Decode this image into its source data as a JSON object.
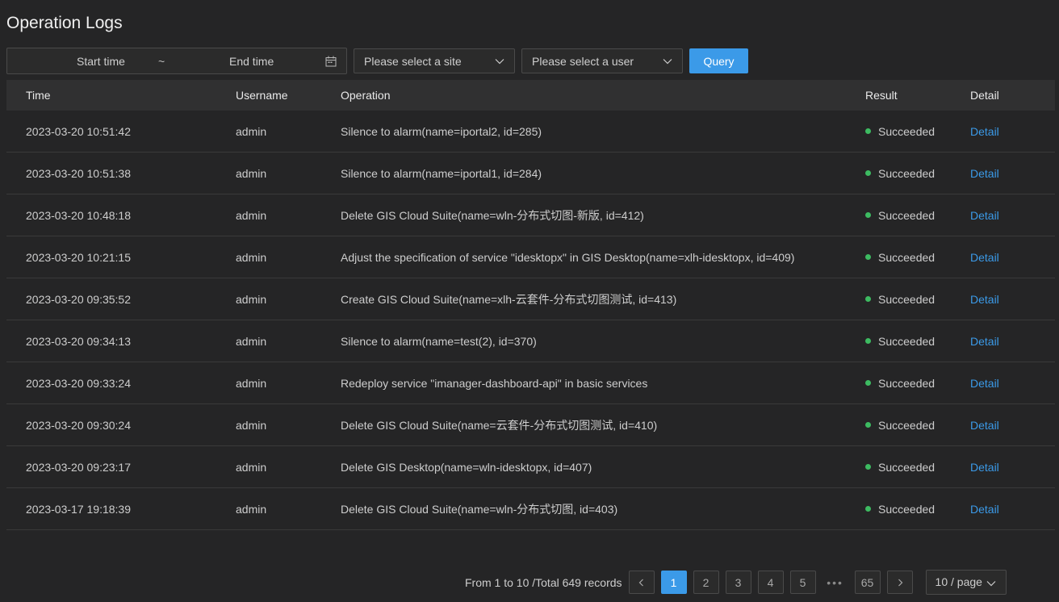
{
  "page": {
    "title": "Operation Logs"
  },
  "toolbar": {
    "start_placeholder": "Start time",
    "separator": "~",
    "end_placeholder": "End time",
    "site_placeholder": "Please select a site",
    "user_placeholder": "Please select a user",
    "query_label": "Query"
  },
  "table": {
    "headers": {
      "time": "Time",
      "username": "Username",
      "operation": "Operation",
      "result": "Result",
      "detail": "Detail"
    },
    "rows": [
      {
        "time": "2023-03-20 10:51:42",
        "username": "admin",
        "operation": "Silence to alarm(name=iportal2, id=285)",
        "result": "Succeeded",
        "detail": "Detail"
      },
      {
        "time": "2023-03-20 10:51:38",
        "username": "admin",
        "operation": "Silence to alarm(name=iportal1, id=284)",
        "result": "Succeeded",
        "detail": "Detail"
      },
      {
        "time": "2023-03-20 10:48:18",
        "username": "admin",
        "operation": "Delete GIS Cloud Suite(name=wln-分布式切图-新版, id=412)",
        "result": "Succeeded",
        "detail": "Detail"
      },
      {
        "time": "2023-03-20 10:21:15",
        "username": "admin",
        "operation": "Adjust the specification of service \"idesktopx\" in GIS Desktop(name=xlh-idesktopx, id=409)",
        "result": "Succeeded",
        "detail": "Detail"
      },
      {
        "time": "2023-03-20 09:35:52",
        "username": "admin",
        "operation": "Create GIS Cloud Suite(name=xlh-云套件-分布式切图测试, id=413)",
        "result": "Succeeded",
        "detail": "Detail"
      },
      {
        "time": "2023-03-20 09:34:13",
        "username": "admin",
        "operation": "Silence to alarm(name=test(2), id=370)",
        "result": "Succeeded",
        "detail": "Detail"
      },
      {
        "time": "2023-03-20 09:33:24",
        "username": "admin",
        "operation": "Redeploy service \"imanager-dashboard-api\" in basic services",
        "result": "Succeeded",
        "detail": "Detail"
      },
      {
        "time": "2023-03-20 09:30:24",
        "username": "admin",
        "operation": "Delete GIS Cloud Suite(name=云套件-分布式切图测试, id=410)",
        "result": "Succeeded",
        "detail": "Detail"
      },
      {
        "time": "2023-03-20 09:23:17",
        "username": "admin",
        "operation": "Delete GIS Desktop(name=wln-idesktopx, id=407)",
        "result": "Succeeded",
        "detail": "Detail"
      },
      {
        "time": "2023-03-17 19:18:39",
        "username": "admin",
        "operation": "Delete GIS Cloud Suite(name=wln-分布式切图, id=403)",
        "result": "Succeeded",
        "detail": "Detail"
      }
    ]
  },
  "pagination": {
    "summary": "From 1 to 10 /Total 649 records",
    "pages": [
      "1",
      "2",
      "3",
      "4",
      "5"
    ],
    "ellipsis": "•••",
    "last_page": "65",
    "current": "1",
    "page_size": "10 / page"
  },
  "colors": {
    "accent": "#3b9ae8",
    "success": "#3dbb61",
    "background": "#252526"
  }
}
